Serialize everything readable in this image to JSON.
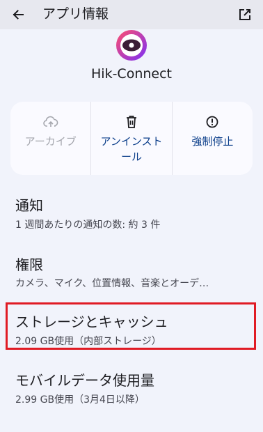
{
  "header": {
    "title": "アプリ情報",
    "back_icon": "arrow-back-icon",
    "open_icon": "open-in-new-icon"
  },
  "app": {
    "name": "Hik-Connect",
    "icon": "hik-connect-app-icon"
  },
  "actions": [
    {
      "label": "アーカイブ",
      "icon": "cloud-upload-icon",
      "enabled": false
    },
    {
      "label": "アンインストール",
      "icon": "trash-icon",
      "enabled": true
    },
    {
      "label": "強制停止",
      "icon": "alert-circle-icon",
      "enabled": true
    }
  ],
  "rows": [
    {
      "title": "通知",
      "subtitle": "1 週間あたりの通知の数: 約 3 件"
    },
    {
      "title": "権限",
      "subtitle": "カメラ、マイク、位置情報、音楽とオーデ…"
    },
    {
      "title": "ストレージとキャッシュ",
      "subtitle": "2.09 GB使用（内部ストレージ）"
    },
    {
      "title": "モバイルデータ使用量",
      "subtitle": "2.99 GB使用（3月4日以降）"
    }
  ],
  "colors": {
    "background": "#f1f3fb",
    "header_bg": "#e7e8ef",
    "action_text": "#0b3e8a",
    "disabled_text": "#a4a6ad",
    "highlight": "#e01b24",
    "icon_ring_start": "#ff4f6d",
    "icon_ring_end": "#7b2ff7"
  }
}
